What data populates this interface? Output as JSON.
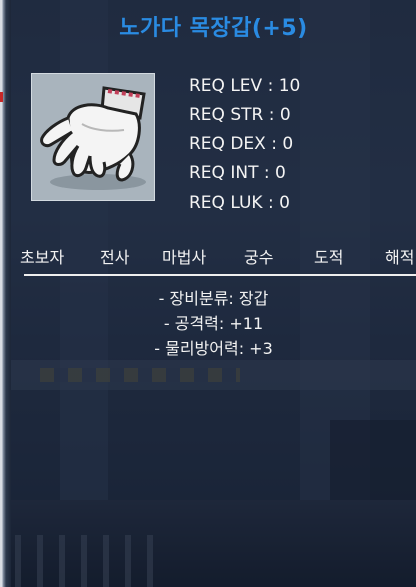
{
  "item": {
    "name": "노가다 목장갑(+5)",
    "icon": "white-glove-icon",
    "name_color": "#2a8be2"
  },
  "requirements": [
    "REQ LEV : 10",
    "REQ STR : 0",
    "REQ DEX : 0",
    "REQ INT : 0",
    "REQ LUK : 0"
  ],
  "jobs": [
    "초보자",
    "전사",
    "마법사",
    "궁수",
    "도적",
    "해적"
  ],
  "stats": [
    "- 장비분류: 장갑",
    "- 공격력: +11",
    "- 물리방어력: +3"
  ]
}
